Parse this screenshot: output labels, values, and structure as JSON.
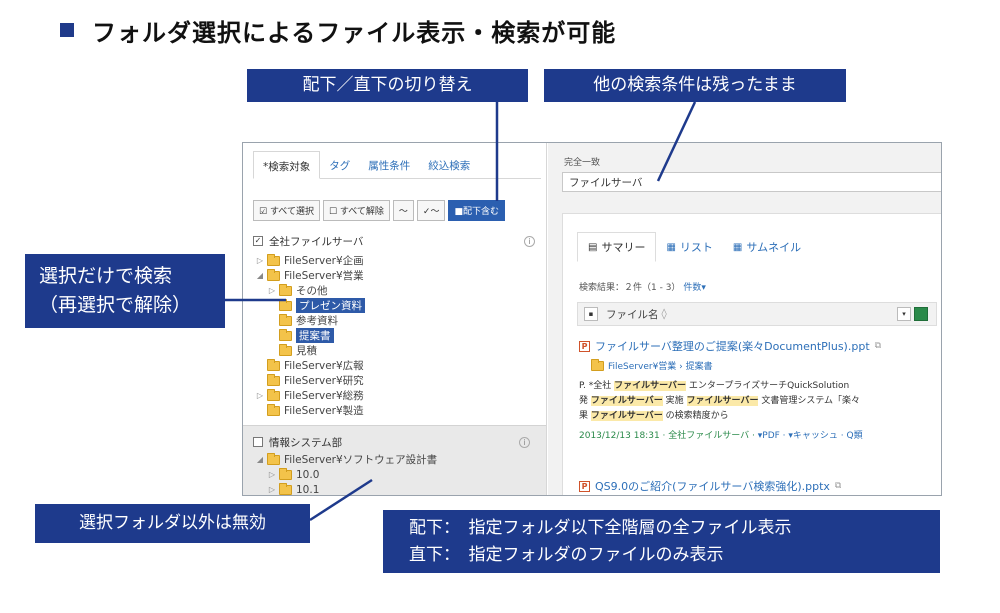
{
  "page": {
    "title": "フォルダ選択によるファイル表示・検索が可能"
  },
  "callouts": {
    "switch": "配下／直下の切り替え",
    "keep": "他の検索条件は残ったまま",
    "select_line1": "選択だけで検索",
    "select_line2": "（再選択で解除）",
    "invalid": "選択フォルダ以外は無効",
    "desc_line1": "配下：　指定フォルダ以下全階層の全ファイル表示",
    "desc_line2": "直下：　指定フォルダのファイルのみ表示"
  },
  "colors": {
    "callout": "#1e3a8c",
    "selected": "#2e5aa8",
    "link": "#2d6fb8",
    "highlight": "#fbe9a8"
  },
  "left": {
    "tabs": [
      "*検索対象",
      "タグ",
      "属性条件",
      "絞込検索"
    ],
    "buttons": {
      "select_all": "すべて選択",
      "deselect_all": "すべて解除",
      "tilde": "〜",
      "check": "✓〜",
      "scope": "配下含む"
    },
    "root1": "全社ファイルサーバ",
    "root1_checked": true,
    "tree": [
      {
        "label": "FileServer¥企画",
        "depth": 0,
        "tw": "▷",
        "sel": false
      },
      {
        "label": "FileServer¥営業",
        "depth": 0,
        "tw": "◢",
        "sel": false
      },
      {
        "label": "その他",
        "depth": 1,
        "tw": "▷",
        "sel": false
      },
      {
        "label": "プレゼン資料",
        "depth": 1,
        "tw": "",
        "sel": true
      },
      {
        "label": "参考資料",
        "depth": 1,
        "tw": "",
        "sel": false
      },
      {
        "label": "提案書",
        "depth": 1,
        "tw": "",
        "sel": true
      },
      {
        "label": "見積",
        "depth": 1,
        "tw": "",
        "sel": false
      },
      {
        "label": "FileServer¥広報",
        "depth": 0,
        "tw": "",
        "sel": false
      },
      {
        "label": "FileServer¥研究",
        "depth": 0,
        "tw": "",
        "sel": false
      },
      {
        "label": "FileServer¥総務",
        "depth": 0,
        "tw": "▷",
        "sel": false
      },
      {
        "label": "FileServer¥製造",
        "depth": 0,
        "tw": "",
        "sel": false
      }
    ],
    "root2": "情報システム部",
    "root2_checked": false,
    "tree2": [
      {
        "label": "FileServer¥ソフトウェア設計書",
        "depth": 0,
        "tw": "◢"
      },
      {
        "label": "10.0",
        "depth": 1,
        "tw": "▷"
      },
      {
        "label": "10.1",
        "depth": 1,
        "tw": "▷"
      }
    ]
  },
  "right": {
    "cond_label": "完全一致",
    "cond_value": "ファイルサーバ",
    "view_tabs": [
      {
        "icon": "▤",
        "label": "サマリー"
      },
      {
        "icon": "▦",
        "label": "リスト"
      },
      {
        "icon": "▦",
        "label": "サムネイル"
      }
    ],
    "summary_prefix": "検索結果：２件（1 - 3）",
    "summary_link": "件数▾",
    "column_header": "ファイル名",
    "results": [
      {
        "title": "ファイルサーバ整理のご提案(楽々DocumentPlus).ppt",
        "path": "FileServer¥営業 › 提案書",
        "snippet1_a": "P. *全社 ",
        "snippet1_hl": "ファイルサーバー",
        "snippet1_b": " エンタープライズサーチQuickSolution",
        "snippet2_a": "発 ",
        "snippet2_hl1": "ファイルサーバー",
        "snippet2_b": " 実施 ",
        "snippet2_hl2": "ファイルサーバー",
        "snippet2_c": " 文書管理システム「楽々",
        "snippet3_a": "果 ",
        "snippet3_hl": "ファイルサーバー",
        "snippet3_b": " の検索精度から",
        "meta": "2013/12/13 18:31 · 全社ファイルサーバ ·",
        "meta_links": "▾PDF · ▾キャッシュ · Q類"
      },
      {
        "title": "QS9.0のご紹介(ファイルサーバ検索強化).pptx"
      }
    ]
  }
}
